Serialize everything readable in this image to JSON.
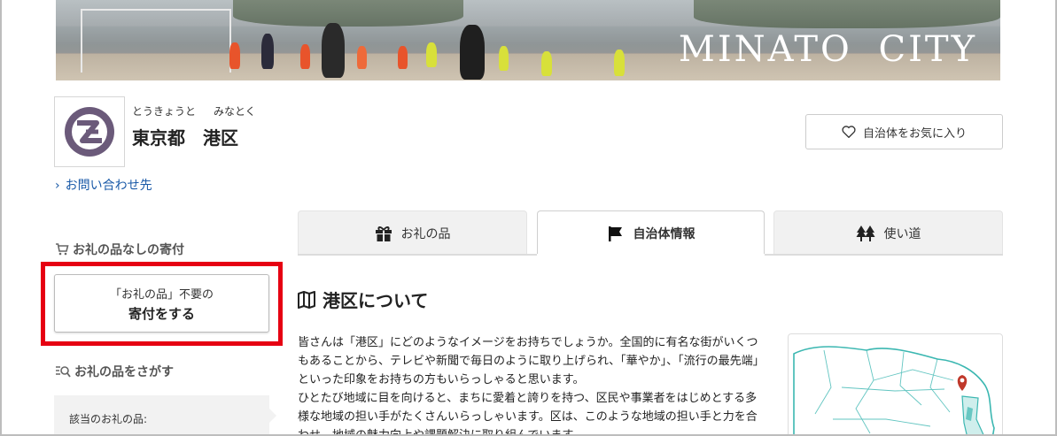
{
  "banner": {
    "title": "MINATO  CITY"
  },
  "header": {
    "ruby_prefecture": "とうきょうと",
    "ruby_city": "みなとく",
    "city_name": "東京都　港区",
    "contact_link": "お問い合わせ先",
    "favorite_button": "自治体をお気に入り"
  },
  "sidebar": {
    "no_gift_heading": "お礼の品なしの寄付",
    "donate_line1": "「お礼の品」不要の",
    "donate_line2": "寄付をする",
    "search_heading": "お礼の品をさがす",
    "filter_label": "該当のお礼の品:"
  },
  "tabs": [
    {
      "label": "お礼の品",
      "icon": "gift-icon"
    },
    {
      "label": "自治体情報",
      "icon": "flag-icon"
    },
    {
      "label": "使い道",
      "icon": "trees-icon"
    }
  ],
  "main": {
    "section_title": "港区について",
    "paragraphs": [
      "皆さんは「港区」にどのようなイメージをお持ちでしょうか。全国的に有名な街がいくつもあることから、テレビや新聞で毎日のように取り上げられ、「華やか」、「流行の最先端」といった印象をお持ちの方もいらっしゃると思います。",
      "ひとたび地域に目を向けると、まちに愛着と誇りを持つ、区民や事業者をはじめとする多様な地域の担い手がたくさんいらっしゃいます。区は、このような地域の担い手と力を合わせ、地域の魅力向上や課題解決に取り組んでいます。"
    ]
  },
  "colors": {
    "accent_red": "#e60012",
    "link_blue": "#1a5aa8",
    "logo_purple": "#6b5a7a",
    "map_teal": "#3bb7b1",
    "pin_red": "#c0392b"
  }
}
